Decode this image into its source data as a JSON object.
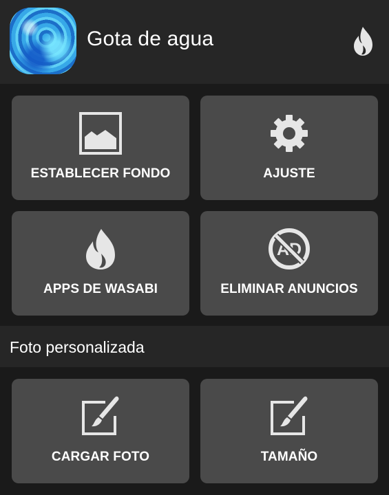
{
  "header": {
    "app_name": "Gota de agua",
    "app_icon": "water-drop-app-icon",
    "menu_icon": "wasabi-flame-icon"
  },
  "actions": [
    {
      "label": "ESTABLECER FONDO",
      "icon": "image-icon"
    },
    {
      "label": "AJUSTE",
      "icon": "gear-icon"
    },
    {
      "label": "APPS DE WASABI",
      "icon": "flame-icon"
    },
    {
      "label": "ELIMINAR ANUNCIOS",
      "icon": "no-ads-icon"
    }
  ],
  "custom_photo": {
    "section_title": "Foto personalizada",
    "actions": [
      {
        "label": "CARGAR FOTO",
        "icon": "edit-brush-icon"
      },
      {
        "label": "TAMAÑO",
        "icon": "edit-brush-icon"
      }
    ]
  },
  "colors": {
    "background": "#1a1a1a",
    "bar": "#262626",
    "card": "#4a4a4a",
    "icon": "#e6e6e6",
    "text": "#ffffff"
  }
}
